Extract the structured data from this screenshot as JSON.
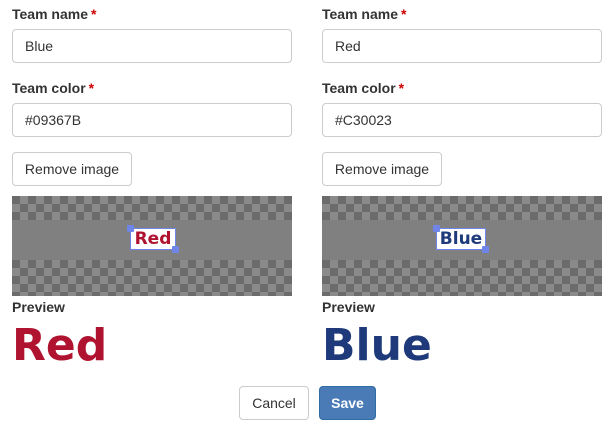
{
  "teams": [
    {
      "team_name_label": "Team name",
      "team_name_value": "Blue",
      "team_color_label": "Team color",
      "team_color_value": "#09367B",
      "required_mark": "*",
      "remove_image_label": "Remove image",
      "image_text": "Red",
      "image_text_color": "#B0132F",
      "preview_label": "Preview",
      "preview_text": "Red",
      "preview_color": "#B0132F"
    },
    {
      "team_name_label": "Team name",
      "team_name_value": "Red",
      "team_color_label": "Team color",
      "team_color_value": "#C30023",
      "required_mark": "*",
      "remove_image_label": "Remove image",
      "image_text": "Blue",
      "image_text_color": "#1E3A7A",
      "preview_label": "Preview",
      "preview_text": "Blue",
      "preview_color": "#1E3A7A"
    }
  ],
  "footer": {
    "cancel_label": "Cancel",
    "save_label": "Save"
  },
  "colors": {
    "primary": "#4A7BB7",
    "required": "#CC0000",
    "selection": "#6F86E8"
  }
}
